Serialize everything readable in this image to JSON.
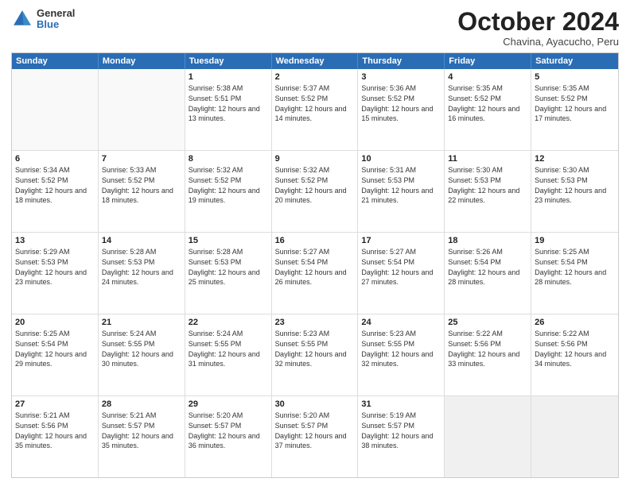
{
  "logo": {
    "general": "General",
    "blue": "Blue"
  },
  "header": {
    "month": "October 2024",
    "location": "Chavina, Ayacucho, Peru"
  },
  "days": [
    "Sunday",
    "Monday",
    "Tuesday",
    "Wednesday",
    "Thursday",
    "Friday",
    "Saturday"
  ],
  "rows": [
    [
      {
        "day": "",
        "sunrise": "",
        "sunset": "",
        "daylight": "",
        "empty": true
      },
      {
        "day": "",
        "sunrise": "",
        "sunset": "",
        "daylight": "",
        "empty": true
      },
      {
        "day": "1",
        "sunrise": "Sunrise: 5:38 AM",
        "sunset": "Sunset: 5:51 PM",
        "daylight": "Daylight: 12 hours and 13 minutes."
      },
      {
        "day": "2",
        "sunrise": "Sunrise: 5:37 AM",
        "sunset": "Sunset: 5:52 PM",
        "daylight": "Daylight: 12 hours and 14 minutes."
      },
      {
        "day": "3",
        "sunrise": "Sunrise: 5:36 AM",
        "sunset": "Sunset: 5:52 PM",
        "daylight": "Daylight: 12 hours and 15 minutes."
      },
      {
        "day": "4",
        "sunrise": "Sunrise: 5:35 AM",
        "sunset": "Sunset: 5:52 PM",
        "daylight": "Daylight: 12 hours and 16 minutes."
      },
      {
        "day": "5",
        "sunrise": "Sunrise: 5:35 AM",
        "sunset": "Sunset: 5:52 PM",
        "daylight": "Daylight: 12 hours and 17 minutes."
      }
    ],
    [
      {
        "day": "6",
        "sunrise": "Sunrise: 5:34 AM",
        "sunset": "Sunset: 5:52 PM",
        "daylight": "Daylight: 12 hours and 18 minutes."
      },
      {
        "day": "7",
        "sunrise": "Sunrise: 5:33 AM",
        "sunset": "Sunset: 5:52 PM",
        "daylight": "Daylight: 12 hours and 18 minutes."
      },
      {
        "day": "8",
        "sunrise": "Sunrise: 5:32 AM",
        "sunset": "Sunset: 5:52 PM",
        "daylight": "Daylight: 12 hours and 19 minutes."
      },
      {
        "day": "9",
        "sunrise": "Sunrise: 5:32 AM",
        "sunset": "Sunset: 5:52 PM",
        "daylight": "Daylight: 12 hours and 20 minutes."
      },
      {
        "day": "10",
        "sunrise": "Sunrise: 5:31 AM",
        "sunset": "Sunset: 5:53 PM",
        "daylight": "Daylight: 12 hours and 21 minutes."
      },
      {
        "day": "11",
        "sunrise": "Sunrise: 5:30 AM",
        "sunset": "Sunset: 5:53 PM",
        "daylight": "Daylight: 12 hours and 22 minutes."
      },
      {
        "day": "12",
        "sunrise": "Sunrise: 5:30 AM",
        "sunset": "Sunset: 5:53 PM",
        "daylight": "Daylight: 12 hours and 23 minutes."
      }
    ],
    [
      {
        "day": "13",
        "sunrise": "Sunrise: 5:29 AM",
        "sunset": "Sunset: 5:53 PM",
        "daylight": "Daylight: 12 hours and 23 minutes."
      },
      {
        "day": "14",
        "sunrise": "Sunrise: 5:28 AM",
        "sunset": "Sunset: 5:53 PM",
        "daylight": "Daylight: 12 hours and 24 minutes."
      },
      {
        "day": "15",
        "sunrise": "Sunrise: 5:28 AM",
        "sunset": "Sunset: 5:53 PM",
        "daylight": "Daylight: 12 hours and 25 minutes."
      },
      {
        "day": "16",
        "sunrise": "Sunrise: 5:27 AM",
        "sunset": "Sunset: 5:54 PM",
        "daylight": "Daylight: 12 hours and 26 minutes."
      },
      {
        "day": "17",
        "sunrise": "Sunrise: 5:27 AM",
        "sunset": "Sunset: 5:54 PM",
        "daylight": "Daylight: 12 hours and 27 minutes."
      },
      {
        "day": "18",
        "sunrise": "Sunrise: 5:26 AM",
        "sunset": "Sunset: 5:54 PM",
        "daylight": "Daylight: 12 hours and 28 minutes."
      },
      {
        "day": "19",
        "sunrise": "Sunrise: 5:25 AM",
        "sunset": "Sunset: 5:54 PM",
        "daylight": "Daylight: 12 hours and 28 minutes."
      }
    ],
    [
      {
        "day": "20",
        "sunrise": "Sunrise: 5:25 AM",
        "sunset": "Sunset: 5:54 PM",
        "daylight": "Daylight: 12 hours and 29 minutes."
      },
      {
        "day": "21",
        "sunrise": "Sunrise: 5:24 AM",
        "sunset": "Sunset: 5:55 PM",
        "daylight": "Daylight: 12 hours and 30 minutes."
      },
      {
        "day": "22",
        "sunrise": "Sunrise: 5:24 AM",
        "sunset": "Sunset: 5:55 PM",
        "daylight": "Daylight: 12 hours and 31 minutes."
      },
      {
        "day": "23",
        "sunrise": "Sunrise: 5:23 AM",
        "sunset": "Sunset: 5:55 PM",
        "daylight": "Daylight: 12 hours and 32 minutes."
      },
      {
        "day": "24",
        "sunrise": "Sunrise: 5:23 AM",
        "sunset": "Sunset: 5:55 PM",
        "daylight": "Daylight: 12 hours and 32 minutes."
      },
      {
        "day": "25",
        "sunrise": "Sunrise: 5:22 AM",
        "sunset": "Sunset: 5:56 PM",
        "daylight": "Daylight: 12 hours and 33 minutes."
      },
      {
        "day": "26",
        "sunrise": "Sunrise: 5:22 AM",
        "sunset": "Sunset: 5:56 PM",
        "daylight": "Daylight: 12 hours and 34 minutes."
      }
    ],
    [
      {
        "day": "27",
        "sunrise": "Sunrise: 5:21 AM",
        "sunset": "Sunset: 5:56 PM",
        "daylight": "Daylight: 12 hours and 35 minutes."
      },
      {
        "day": "28",
        "sunrise": "Sunrise: 5:21 AM",
        "sunset": "Sunset: 5:57 PM",
        "daylight": "Daylight: 12 hours and 35 minutes."
      },
      {
        "day": "29",
        "sunrise": "Sunrise: 5:20 AM",
        "sunset": "Sunset: 5:57 PM",
        "daylight": "Daylight: 12 hours and 36 minutes."
      },
      {
        "day": "30",
        "sunrise": "Sunrise: 5:20 AM",
        "sunset": "Sunset: 5:57 PM",
        "daylight": "Daylight: 12 hours and 37 minutes."
      },
      {
        "day": "31",
        "sunrise": "Sunrise: 5:19 AM",
        "sunset": "Sunset: 5:57 PM",
        "daylight": "Daylight: 12 hours and 38 minutes."
      },
      {
        "day": "",
        "sunrise": "",
        "sunset": "",
        "daylight": "",
        "empty": true,
        "shaded": true
      },
      {
        "day": "",
        "sunrise": "",
        "sunset": "",
        "daylight": "",
        "empty": true,
        "shaded": true
      }
    ]
  ]
}
